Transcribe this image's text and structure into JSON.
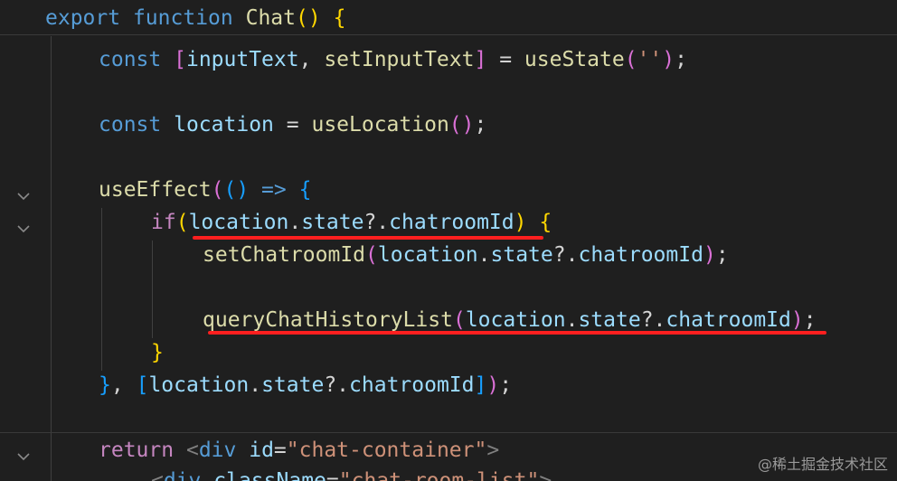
{
  "code": {
    "l1": {
      "a": "export",
      "b": "function",
      "c": "Chat",
      "d": "(",
      "e": ")",
      "f": "{"
    },
    "l2": {
      "a": "const",
      "b": "[",
      "c": "inputText",
      "d": ",",
      "e": "setInputText",
      "f": "]",
      "g": "=",
      "h": "useState",
      "i": "(",
      "j": "''",
      "k": ")",
      "l": ";"
    },
    "l4": {
      "a": "const",
      "b": "location",
      "c": "=",
      "d": "useLocation",
      "e": "(",
      "f": ")",
      "g": ";"
    },
    "l6": {
      "a": "useEffect",
      "b": "(",
      "c": "()",
      "d": "=>",
      "e": "{"
    },
    "l7": {
      "a": "if",
      "b": "(",
      "c": "location",
      "d": ".",
      "e": "state",
      "f": "?.",
      "g": "chatroomId",
      "h": ")",
      "i": "{"
    },
    "l8": {
      "a": "setChatroomId",
      "b": "(",
      "c": "location",
      "d": ".",
      "e": "state",
      "f": "?.",
      "g": "chatroomId",
      "h": ")",
      "i": ";"
    },
    "l10": {
      "a": "queryChatHistoryList",
      "b": "(",
      "c": "location",
      "d": ".",
      "e": "state",
      "f": "?.",
      "g": "chatroomId",
      "h": ")",
      "i": ";"
    },
    "l11": {
      "a": "}"
    },
    "l12": {
      "a": "}",
      "b": ",",
      "c": "[",
      "d": "location",
      "e": ".",
      "f": "state",
      "g": "?.",
      "h": "chatroomId",
      "i": "]",
      "j": ")",
      "k": ";"
    },
    "l14": {
      "a": "return",
      "b": "<",
      "c": "div",
      "d": "id",
      "e": "=",
      "f": "\"chat-container\"",
      "g": ">"
    },
    "l15": {
      "a": "<",
      "b": "div",
      "c": "className",
      "d": "=",
      "e": "\"chat-room-list\"",
      "f": ">"
    }
  },
  "colors": {
    "background": "#1f1f1f",
    "keyword": "#569cd6",
    "control": "#c586c0",
    "function": "#dcdcaa",
    "variable": "#9cdcfe",
    "string": "#ce9178",
    "underline": "#ff1f1f"
  },
  "icons": {
    "fold": "chevron-down-icon"
  },
  "watermark": "@稀土掘金技术社区"
}
